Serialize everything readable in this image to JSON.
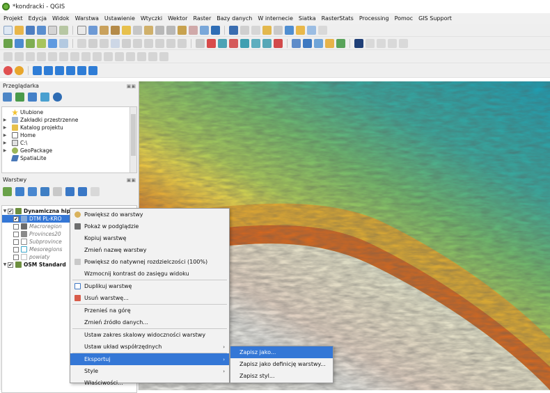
{
  "window": {
    "title": "*kondracki - QGIS"
  },
  "menubar": [
    "Projekt",
    "Edycja",
    "Widok",
    "Warstwa",
    "Ustawienie",
    "Wtyczki",
    "Wektor",
    "Raster",
    "Bazy danych",
    "W internecie",
    "Siatka",
    "RasterStats",
    "Processing",
    "Pomoc",
    "GIS Support"
  ],
  "browser_panel": {
    "title": "Przeglądarka",
    "items": [
      {
        "label": "Ulubione",
        "icon": "star-icon"
      },
      {
        "label": "Zakładki przestrzenne",
        "icon": "bookmark-icon"
      },
      {
        "label": "Katalog projektu",
        "icon": "folder-icon"
      },
      {
        "label": "Home",
        "icon": "home-icon"
      },
      {
        "label": "C:\\",
        "icon": "drive-icon"
      },
      {
        "label": "GeoPackage",
        "icon": "geopackage-icon"
      },
      {
        "label": "SpatiaLite",
        "icon": "spatialite-icon"
      }
    ]
  },
  "layers_panel": {
    "title": "Warstwy",
    "group1": "Dynamiczna hipsometria",
    "layers": [
      "DTM PL-KRO",
      "Macroregion",
      "Provinces20",
      "Subprovince",
      "Mesoregions",
      "powiaty"
    ],
    "group2": "OSM Standard"
  },
  "context_menu": {
    "items": [
      "Powiększ do warstwy",
      "Pokaż w podglądzie",
      "Kopiuj warstwę",
      "Zmień nazwę warstwy",
      "Powiększ do natywnej rozdzielczości (100%)",
      "Wzmocnij kontrast do zasięgu widoku",
      "Duplikuj warstwę",
      "Usuń warstwę...",
      "Przenieś na górę",
      "Zmień źródło danych...",
      "Ustaw zakres skalowy widoczności warstwy",
      "Ustaw układ współrzędnych",
      "Eksportuj",
      "Style",
      "Właściwości..."
    ]
  },
  "export_submenu": {
    "items": [
      "Zapisz jako...",
      "Zapisz jako definicję warstwy...",
      "Zapisz styl..."
    ]
  },
  "colors": {
    "highlight": "#3477d6",
    "qgis_green": "#6bb33c"
  }
}
